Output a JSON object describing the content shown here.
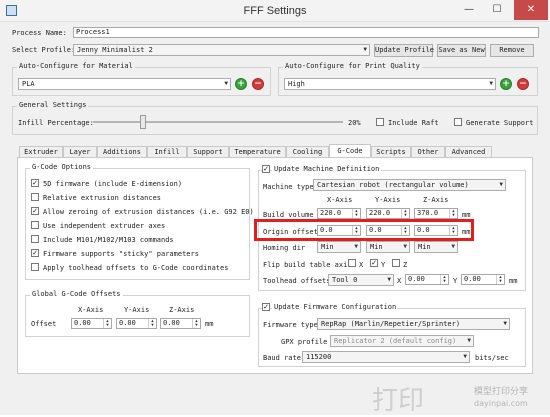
{
  "window": {
    "title": "FFF Settings"
  },
  "titlebar": {
    "minimize": "—",
    "maximize": "☐",
    "close": "✕"
  },
  "process": {
    "name_label": "Process Name:",
    "name_value": "Process1"
  },
  "profile": {
    "label": "Select Profile:",
    "value": "Jenny Minimalist 2",
    "update_button": "Update Profile",
    "save_button": "Save as New",
    "remove_button": "Remove"
  },
  "material": {
    "label": "Auto-Configure for Material",
    "value": "PLA"
  },
  "quality": {
    "label": "Auto-Configure for Print Quality",
    "value": "High"
  },
  "general": {
    "label": "General Settings",
    "infill_label": "Infill Percentage:",
    "infill_value": "20%",
    "infill_fraction": 0.2,
    "raft_label": "Include Raft",
    "support_label": "Generate Support"
  },
  "tabs": [
    {
      "label": "Extruder"
    },
    {
      "label": "Layer"
    },
    {
      "label": "Additions"
    },
    {
      "label": "Infill"
    },
    {
      "label": "Support"
    },
    {
      "label": "Temperature"
    },
    {
      "label": "Cooling"
    },
    {
      "label": "G-Code",
      "active": true
    },
    {
      "label": "Scripts"
    },
    {
      "label": "Other"
    },
    {
      "label": "Advanced"
    }
  ],
  "gcode_options": {
    "label": "G-Code Options",
    "items": [
      {
        "label": "5D firmware (include E-dimension)",
        "checked": true
      },
      {
        "label": "Relative extrusion distances",
        "checked": false
      },
      {
        "label": "Allow zeroing of extrusion distances (i.e. G92 E0)",
        "checked": true
      },
      {
        "label": "Use independent extruder axes",
        "checked": false
      },
      {
        "label": "Include M101/M102/M103 commands",
        "checked": false
      },
      {
        "label": "Firmware supports \"sticky\" parameters",
        "checked": true
      },
      {
        "label": "Apply toolhead offsets to G-Code coordinates",
        "checked": false
      }
    ]
  },
  "global_offsets": {
    "label": "Global G-Code Offsets",
    "x_header": "X-Axis",
    "y_header": "Y-Axis",
    "z_header": "Z-Axis",
    "row_label": "Offset",
    "x": "0.00",
    "y": "0.00",
    "z": "0.00",
    "unit": "mm"
  },
  "machine": {
    "update_label": "Update Machine Definition",
    "update_checked": true,
    "type_label": "Machine type",
    "type_value": "Cartesian robot (rectangular volume)",
    "x_header": "X-Axis",
    "y_header": "Y-Axis",
    "z_header": "Z-Axis",
    "build_label": "Build volume",
    "build_x": "220.0",
    "build_y": "220.0",
    "build_z": "370.0",
    "origin_label": "Origin offset",
    "origin_x": "0.0",
    "origin_y": "0.0",
    "origin_z": "0.0",
    "homing_label": "Homing dir",
    "homing_x": "Min",
    "homing_y": "Min",
    "homing_z": "Min",
    "flip_label": "Flip build table axis",
    "flip_x_label": "X",
    "flip_x_checked": false,
    "flip_y_label": "Y",
    "flip_y_checked": true,
    "flip_z_label": "Z",
    "flip_z_checked": false,
    "toolhead_label": "Toolhead offsets",
    "toolhead_value": "Tool 0",
    "tool_x_label": "X",
    "tool_x": "0.00",
    "tool_y_label": "Y",
    "tool_y": "0.00",
    "unit": "mm"
  },
  "firmware": {
    "update_label": "Update Firmware Configuration",
    "update_checked": true,
    "type_label": "Firmware type",
    "type_value": "RepRap (Marlin/Repetier/Sprinter)",
    "gpx_label": "GPX profile",
    "gpx_value": "Replicator 2 (default config)",
    "baud_label": "Baud rate",
    "baud_value": "115200",
    "baud_unit": "bits/sec"
  },
  "watermark": {
    "big": "打印",
    "cn": "模型打印分享",
    "url": "dayinpai.com"
  }
}
